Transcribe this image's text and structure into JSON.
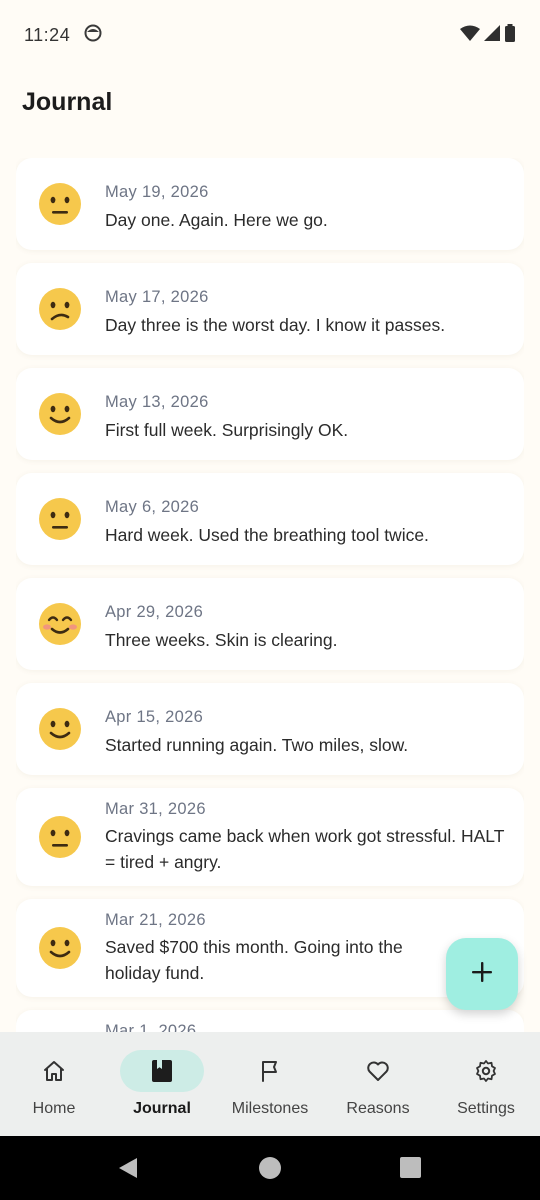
{
  "status_bar": {
    "time": "11:24",
    "left_icon": "notification-face-icon",
    "right_icons": [
      "wifi-icon",
      "signal-icon",
      "battery-icon"
    ]
  },
  "page": {
    "title": "Journal"
  },
  "entries": [
    {
      "date": "May 19, 2026",
      "text": "Day one. Again. Here we go.",
      "mood": "neutral-face-icon"
    },
    {
      "date": "May 17, 2026",
      "text": "Day three is the worst day. I know it passes.",
      "mood": "confused-face-icon"
    },
    {
      "date": "May 13, 2026",
      "text": "First full week. Surprisingly OK.",
      "mood": "slightly-smiling-face-icon"
    },
    {
      "date": "May 6, 2026",
      "text": "Hard week. Used the breathing tool twice.",
      "mood": "neutral-face-icon"
    },
    {
      "date": "Apr 29, 2026",
      "text": "Three weeks. Skin is clearing.",
      "mood": "smiling-blush-face-icon"
    },
    {
      "date": "Apr 15, 2026",
      "text": "Started running again. Two miles, slow.",
      "mood": "slightly-smiling-face-icon"
    },
    {
      "date": "Mar 31, 2026",
      "text": "Cravings came back when work got stressful. HALT = tired + angry.",
      "mood": "neutral-face-icon"
    },
    {
      "date": "Mar 21, 2026",
      "text": "Saved $700 this month. Going into the holiday fund.",
      "mood": "slightly-smiling-face-icon"
    },
    {
      "date": "Mar 1, 2026",
      "text": "",
      "mood": ""
    }
  ],
  "fab": {
    "icon": "plus-icon"
  },
  "bottom_nav": {
    "active": "Journal",
    "items": [
      {
        "label": "Home",
        "icon": "home-icon"
      },
      {
        "label": "Journal",
        "icon": "journal-book-icon"
      },
      {
        "label": "Milestones",
        "icon": "flag-icon"
      },
      {
        "label": "Reasons",
        "icon": "heart-icon"
      },
      {
        "label": "Settings",
        "icon": "gear-icon"
      }
    ]
  },
  "system_nav": [
    "back-icon",
    "home-circle-icon",
    "recents-icon"
  ],
  "colors": {
    "background": "#FFFCF6",
    "card": "#FFFFFF",
    "date_text": "#6E7585",
    "fab": "#9FEEE1",
    "nav_bar": "#EDEFEE",
    "nav_active_pill": "#CDECE6",
    "emoji_face": "#F6C84C"
  }
}
